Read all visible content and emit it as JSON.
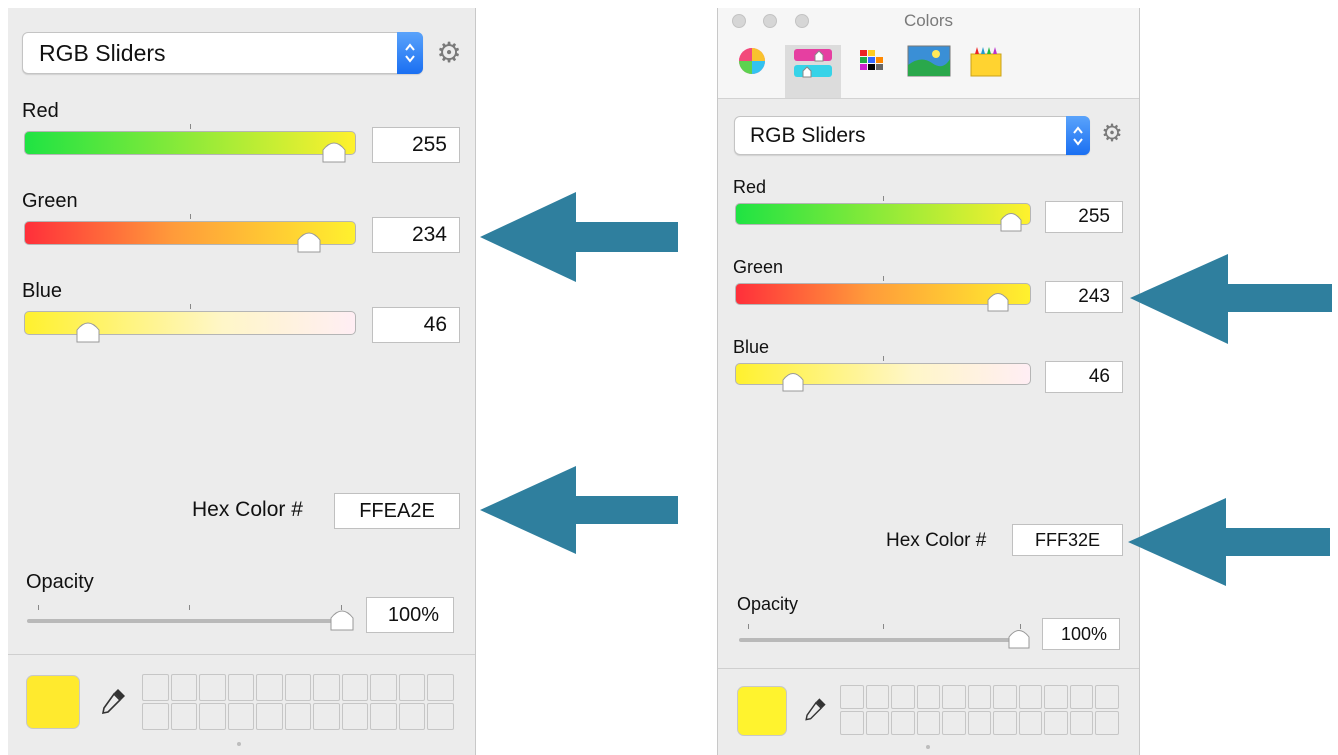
{
  "left": {
    "mode_select": "RGB Sliders",
    "sliders": [
      {
        "label": "Red",
        "value": "255",
        "level": 1.0
      },
      {
        "label": "Green",
        "value": "234",
        "level": 0.918
      },
      {
        "label": "Blue",
        "value": "46",
        "level": 0.18
      }
    ],
    "hex_label": "Hex Color #",
    "hex_value": "FFEA2E",
    "opacity_label": "Opacity",
    "opacity_value": "100%",
    "opacity_level": 1.0,
    "swatch_color": "#FFEA2E"
  },
  "right": {
    "window_title": "Colors",
    "tabs": [
      "color-wheel-icon",
      "color-sliders-icon",
      "color-palettes-icon",
      "image-palettes-icon",
      "crayons-icon"
    ],
    "selected_tab": "color-sliders-icon",
    "mode_select": "RGB Sliders",
    "sliders": [
      {
        "label": "Red",
        "value": "255",
        "level": 1.0
      },
      {
        "label": "Green",
        "value": "243",
        "level": 0.953
      },
      {
        "label": "Blue",
        "value": "46",
        "level": 0.18
      }
    ],
    "hex_label": "Hex Color #",
    "hex_value": "FFF32E",
    "opacity_label": "Opacity",
    "opacity_value": "100%",
    "opacity_level": 1.0,
    "swatch_color": "#FFF32E"
  },
  "colors": {
    "arrow": "#2f7f9e",
    "accent_blue": "#1a6ff2",
    "panel_bg": "#ececec"
  }
}
